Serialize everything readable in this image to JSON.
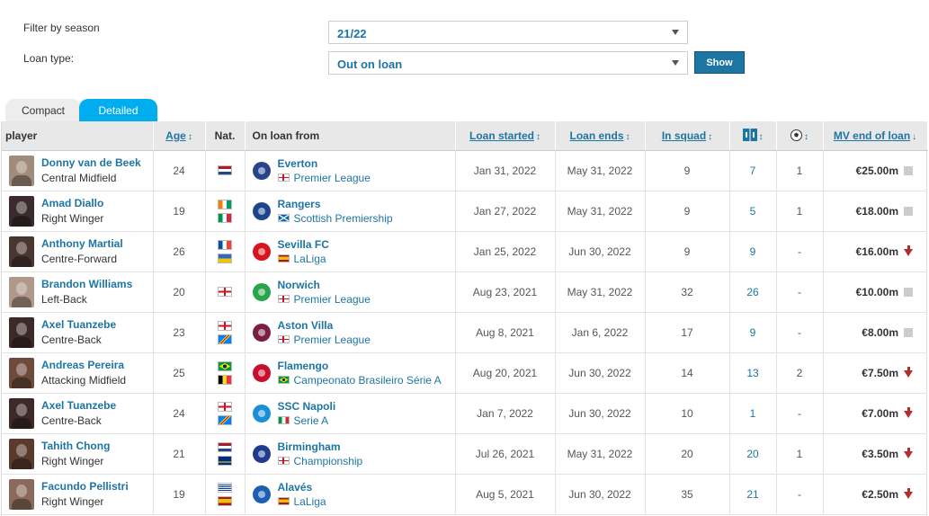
{
  "filters": {
    "season_label": "Filter by season",
    "season_value": "21/22",
    "loan_type_label": "Loan type:",
    "loan_type_value": "Out on loan",
    "show_label": "Show"
  },
  "tabs": [
    {
      "label": "Compact",
      "active": false
    },
    {
      "label": "Detailed",
      "active": true
    }
  ],
  "columns": {
    "player": "player",
    "age": "Age",
    "nat": "Nat.",
    "loan_from": "On loan from",
    "loan_started": "Loan started",
    "loan_ends": "Loan ends",
    "in_squad": "In squad",
    "mv_end": "MV end of loan"
  },
  "icons": {
    "appearances": "lineup-icon",
    "goals": "ball-icon"
  },
  "rows": [
    {
      "name": "Donny van de Beek",
      "position": "Central Midfield",
      "age": "24",
      "flags": [
        "nl"
      ],
      "club": "Everton",
      "crest_color": "#274488",
      "league": "Premier League",
      "league_flag": "en",
      "started": "Jan 31, 2022",
      "ends": "May 31, 2022",
      "squad": "9",
      "apps": "7",
      "goals": "1",
      "mv": "€25.00m",
      "trend": "same",
      "photo_color": "#a08c7c"
    },
    {
      "name": "Amad Diallo",
      "position": "Right Winger",
      "age": "19",
      "flags": [
        "ci",
        "it"
      ],
      "club": "Rangers",
      "crest_color": "#1b458f",
      "league": "Scottish Premiership",
      "league_flag": "sc",
      "started": "Jan 27, 2022",
      "ends": "May 31, 2022",
      "squad": "9",
      "apps": "5",
      "goals": "1",
      "mv": "€18.00m",
      "trend": "same",
      "photo_color": "#3a2c2c"
    },
    {
      "name": "Anthony Martial",
      "position": "Centre-Forward",
      "age": "26",
      "flags": [
        "fr",
        "gp"
      ],
      "club": "Sevilla FC",
      "crest_color": "#d8141c",
      "league": "LaLiga",
      "league_flag": "es",
      "started": "Jan 25, 2022",
      "ends": "Jun 30, 2022",
      "squad": "9",
      "apps": "9",
      "goals": "-",
      "mv": "€16.00m",
      "trend": "down",
      "photo_color": "#4a3630"
    },
    {
      "name": "Brandon Williams",
      "position": "Left-Back",
      "age": "20",
      "flags": [
        "en"
      ],
      "club": "Norwich",
      "crest_color": "#28a54a",
      "league": "Premier League",
      "league_flag": "en",
      "started": "Aug 23, 2021",
      "ends": "May 31, 2022",
      "squad": "32",
      "apps": "26",
      "goals": "-",
      "mv": "€10.00m",
      "trend": "same",
      "photo_color": "#b0998a"
    },
    {
      "name": "Axel Tuanzebe",
      "position": "Centre-Back",
      "age": "23",
      "flags": [
        "en",
        "cd"
      ],
      "club": "Aston Villa",
      "crest_color": "#7a1e43",
      "league": "Premier League",
      "league_flag": "en",
      "started": "Aug 8, 2021",
      "ends": "Jan 6, 2022",
      "squad": "17",
      "apps": "9",
      "goals": "-",
      "mv": "€8.00m",
      "trend": "same",
      "photo_color": "#3b2a28"
    },
    {
      "name": "Andreas Pereira",
      "position": "Attacking Midfield",
      "age": "25",
      "flags": [
        "br",
        "be"
      ],
      "club": "Flamengo",
      "crest_color": "#c8102e",
      "league": "Campeonato Brasileiro Série A",
      "league_flag": "br",
      "started": "Aug 20, 2021",
      "ends": "Jun 30, 2022",
      "squad": "14",
      "apps": "13",
      "goals": "2",
      "mv": "€7.50m",
      "trend": "down",
      "photo_color": "#6e4a3c"
    },
    {
      "name": "Axel Tuanzebe",
      "position": "Centre-Back",
      "age": "24",
      "flags": [
        "en",
        "cd"
      ],
      "club": "SSC Napoli",
      "crest_color": "#1a8fd6",
      "league": "Serie A",
      "league_flag": "it",
      "started": "Jan 7, 2022",
      "ends": "Jun 30, 2022",
      "squad": "10",
      "apps": "1",
      "goals": "-",
      "mv": "€7.00m",
      "trend": "down",
      "photo_color": "#3b2a28"
    },
    {
      "name": "Tahith Chong",
      "position": "Right Winger",
      "age": "21",
      "flags": [
        "nl",
        "cw"
      ],
      "club": "Birmingham",
      "crest_color": "#1f3b8f",
      "league": "Championship",
      "league_flag": "en",
      "started": "Jul 26, 2021",
      "ends": "May 31, 2022",
      "squad": "20",
      "apps": "20",
      "goals": "1",
      "mv": "€3.50m",
      "trend": "down",
      "photo_color": "#5a3a2c"
    },
    {
      "name": "Facundo Pellistri",
      "position": "Right Winger",
      "age": "19",
      "flags": [
        "uy",
        "es"
      ],
      "club": "Alavés",
      "crest_color": "#1d5fb4",
      "league": "LaLiga",
      "league_flag": "es",
      "started": "Aug 5, 2021",
      "ends": "Jun 30, 2022",
      "squad": "35",
      "apps": "21",
      "goals": "-",
      "mv": "€2.50m",
      "trend": "down",
      "photo_color": "#8a6a58"
    }
  ]
}
